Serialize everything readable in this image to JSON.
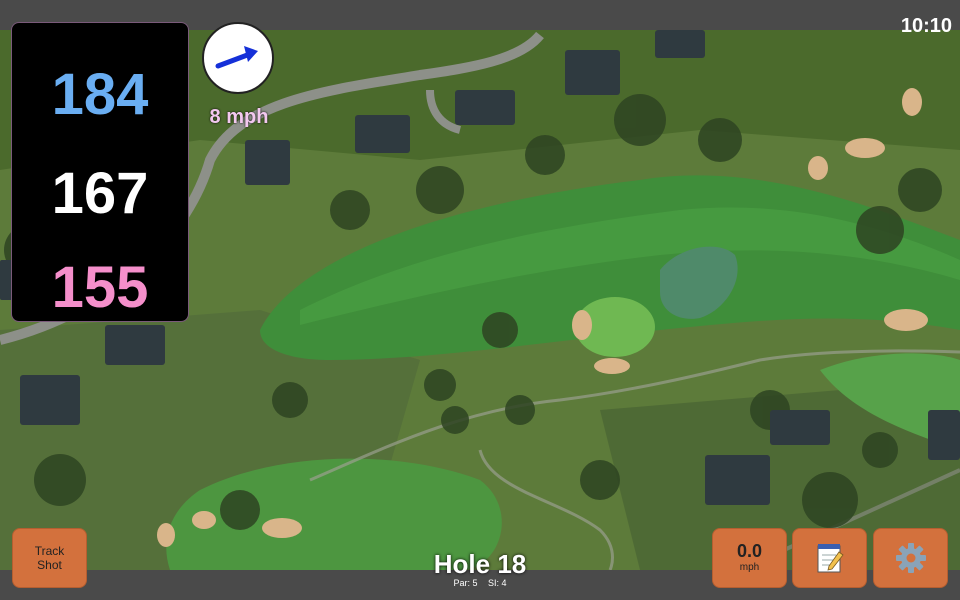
{
  "status_bar": {
    "time": "10:10"
  },
  "distances": {
    "back": "184",
    "middle": "167",
    "front": "155"
  },
  "wind": {
    "speed": "8 mph",
    "icon": "wind-arrow-icon"
  },
  "buttons": {
    "track_shot": {
      "line1": "Track",
      "line2": "Shot"
    },
    "speed": {
      "value": "0.0",
      "unit": "mph"
    },
    "notes_icon": "notepad-icon",
    "settings_icon": "gear-icon"
  },
  "hole": {
    "title": "Hole 18",
    "par": "Par: 5",
    "si": "SI: 4"
  },
  "colors": {
    "back_distance": "#6aaef2",
    "middle_distance": "#ffffff",
    "front_distance": "#f58fcb",
    "button": "#d3713d",
    "wind_text": "#f3c8ef"
  }
}
